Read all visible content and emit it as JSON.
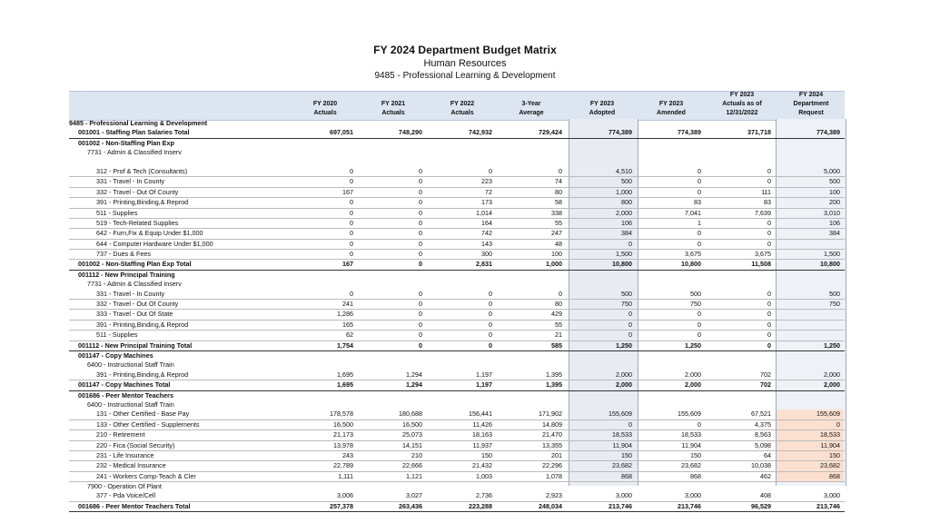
{
  "title": "FY 2024 Department Budget Matrix",
  "subtitle": "Human Resources",
  "subtitle2": "9485 - Professional Learning & Development",
  "columns": [
    [
      "FY 2020",
      "Actuals"
    ],
    [
      "FY 2021",
      "Actuals"
    ],
    [
      "FY 2022",
      "Actuals"
    ],
    [
      "3-Year",
      "Average"
    ],
    [
      "FY 2023",
      "Adopted"
    ],
    [
      "FY 2023",
      "Amended"
    ],
    [
      "FY 2023",
      "Actuals as of",
      "12/31/2022"
    ],
    [
      "FY 2024",
      "Department",
      "Request"
    ]
  ],
  "rows": [
    {
      "label": "9485 - Professional Learning & Development",
      "indent": 0,
      "type": "hd",
      "values": []
    },
    {
      "label": "001001 - Staffing Plan Salaries Total",
      "indent": 1,
      "type": "total",
      "values": [
        "697,051",
        "748,290",
        "742,932",
        "729,424",
        "774,389",
        "774,389",
        "371,718",
        "774,389"
      ]
    },
    {
      "label": "001002 - Non-Staffing Plan Exp",
      "indent": 1,
      "type": "hd",
      "values": []
    },
    {
      "label": "7731 - Admin & Classified Inserv",
      "indent": 2,
      "type": "",
      "values": []
    },
    {
      "label": "",
      "indent": 0,
      "type": "",
      "values": []
    },
    {
      "label": "312 - Prof & Tech (Consultants)",
      "indent": 3,
      "type": "line",
      "values": [
        "0",
        "0",
        "0",
        "0",
        "4,510",
        "0",
        "0",
        "5,000"
      ]
    },
    {
      "label": "331 - Travel - In County",
      "indent": 3,
      "type": "line",
      "values": [
        "0",
        "0",
        "223",
        "74",
        "500",
        "0",
        "0",
        "500"
      ]
    },
    {
      "label": "332 - Travel - Out Of County",
      "indent": 3,
      "type": "line",
      "values": [
        "167",
        "0",
        "72",
        "80",
        "1,000",
        "0",
        "111",
        "100"
      ]
    },
    {
      "label": "391 - Printing,Binding,& Reprod",
      "indent": 3,
      "type": "line",
      "values": [
        "0",
        "0",
        "173",
        "58",
        "800",
        "83",
        "83",
        "200"
      ]
    },
    {
      "label": "511 - Supplies",
      "indent": 3,
      "type": "line",
      "values": [
        "0",
        "0",
        "1,014",
        "338",
        "2,000",
        "7,041",
        "7,639",
        "3,010"
      ]
    },
    {
      "label": "519 - Tech-Related Supplies",
      "indent": 3,
      "type": "line",
      "values": [
        "0",
        "0",
        "164",
        "55",
        "106",
        "1",
        "0",
        "106"
      ]
    },
    {
      "label": "642 - Furn,Fix & Equip Under $1,000",
      "indent": 3,
      "type": "line",
      "values": [
        "0",
        "0",
        "742",
        "247",
        "384",
        "0",
        "0",
        "384"
      ]
    },
    {
      "label": "644 - Computer Hardware Under $1,000",
      "indent": 3,
      "type": "line",
      "values": [
        "0",
        "0",
        "143",
        "48",
        "0",
        "0",
        "0",
        ""
      ]
    },
    {
      "label": "737 - Dues & Fees",
      "indent": 3,
      "type": "line",
      "values": [
        "0",
        "0",
        "300",
        "100",
        "1,500",
        "3,675",
        "3,675",
        "1,500"
      ]
    },
    {
      "label": "001002 - Non-Staffing Plan Exp Total",
      "indent": 1,
      "type": "total",
      "values": [
        "167",
        "0",
        "2,831",
        "1,000",
        "10,800",
        "10,800",
        "11,508",
        "10,800"
      ]
    },
    {
      "label": "001112 - New Principal Training",
      "indent": 1,
      "type": "hd",
      "values": []
    },
    {
      "label": "7731 - Admin & Classified Inserv",
      "indent": 2,
      "type": "",
      "values": []
    },
    {
      "label": "331 - Travel - In County",
      "indent": 3,
      "type": "line",
      "values": [
        "0",
        "0",
        "0",
        "0",
        "500",
        "500",
        "0",
        "500"
      ]
    },
    {
      "label": "332 - Travel - Out Of County",
      "indent": 3,
      "type": "line",
      "values": [
        "241",
        "0",
        "0",
        "80",
        "750",
        "750",
        "0",
        "750"
      ]
    },
    {
      "label": "333 - Travel - Out Of State",
      "indent": 3,
      "type": "line",
      "values": [
        "1,286",
        "0",
        "0",
        "429",
        "0",
        "0",
        "0",
        ""
      ]
    },
    {
      "label": "391 - Printing,Binding,& Reprod",
      "indent": 3,
      "type": "line",
      "values": [
        "165",
        "0",
        "0",
        "55",
        "0",
        "0",
        "0",
        ""
      ]
    },
    {
      "label": "511 - Supplies",
      "indent": 3,
      "type": "line",
      "values": [
        "62",
        "0",
        "0",
        "21",
        "0",
        "0",
        "0",
        ""
      ]
    },
    {
      "label": "001112 - New Principal Training Total",
      "indent": 1,
      "type": "total",
      "values": [
        "1,754",
        "0",
        "0",
        "585",
        "1,250",
        "1,250",
        "0",
        "1,250"
      ]
    },
    {
      "label": "001147 - Copy Machines",
      "indent": 1,
      "type": "hd",
      "values": []
    },
    {
      "label": "6400 - Instructional Staff Train",
      "indent": 2,
      "type": "",
      "values": []
    },
    {
      "label": "391 - Printing,Binding,& Reprod",
      "indent": 3,
      "type": "line",
      "values": [
        "1,695",
        "1,294",
        "1,197",
        "1,395",
        "2,000",
        "2,000",
        "702",
        "2,000"
      ]
    },
    {
      "label": "001147 - Copy Machines Total",
      "indent": 1,
      "type": "total",
      "values": [
        "1,695",
        "1,294",
        "1,197",
        "1,395",
        "2,000",
        "2,000",
        "702",
        "2,000"
      ]
    },
    {
      "label": "001686 - Peer Mentor Teachers",
      "indent": 1,
      "type": "hd",
      "values": []
    },
    {
      "label": "6400 - Instructional Staff Train",
      "indent": 2,
      "type": "",
      "values": []
    },
    {
      "label": "131 - Other Certified - Base Pay",
      "indent": 3,
      "type": "line",
      "hl": true,
      "values": [
        "178,578",
        "180,688",
        "156,441",
        "171,902",
        "155,609",
        "155,609",
        "67,521",
        "155,609"
      ]
    },
    {
      "label": "133 - Other Certified - Supplements",
      "indent": 3,
      "type": "line",
      "hl": true,
      "values": [
        "16,500",
        "16,500",
        "11,426",
        "14,809",
        "0",
        "0",
        "4,375",
        "0"
      ]
    },
    {
      "label": "210 - Retirement",
      "indent": 3,
      "type": "line",
      "hl": true,
      "values": [
        "21,173",
        "25,073",
        "18,163",
        "21,470",
        "18,533",
        "18,533",
        "8,563",
        "18,533"
      ]
    },
    {
      "label": "220 - Fica (Social Security)",
      "indent": 3,
      "type": "line",
      "hl": true,
      "values": [
        "13,978",
        "14,151",
        "11,937",
        "13,355",
        "11,904",
        "11,904",
        "5,098",
        "11,904"
      ]
    },
    {
      "label": "231 - Life Insurance",
      "indent": 3,
      "type": "line",
      "hl": true,
      "values": [
        "243",
        "210",
        "150",
        "201",
        "150",
        "150",
        "64",
        "150"
      ]
    },
    {
      "label": "232 - Medical Insurance",
      "indent": 3,
      "type": "line",
      "hl": true,
      "values": [
        "22,789",
        "22,666",
        "21,432",
        "22,296",
        "23,682",
        "23,682",
        "10,038",
        "23,682"
      ]
    },
    {
      "label": "241 - Workers Comp-Teach & Cler",
      "indent": 3,
      "type": "line",
      "hl": true,
      "values": [
        "1,111",
        "1,121",
        "1,003",
        "1,078",
        "868",
        "868",
        "462",
        "868"
      ]
    },
    {
      "label": "7900 - Operation Of Plant",
      "indent": 2,
      "type": "",
      "values": []
    },
    {
      "label": "377 - Pda Voice/Cell",
      "indent": 3,
      "type": "line",
      "values": [
        "3,006",
        "3,027",
        "2,736",
        "2,923",
        "3,000",
        "3,000",
        "408",
        "3,000"
      ]
    },
    {
      "label": "001686 - Peer Mentor Teachers Total",
      "indent": 1,
      "type": "total",
      "values": [
        "257,378",
        "263,436",
        "223,288",
        "248,034",
        "213,746",
        "213,746",
        "96,529",
        "213,746"
      ]
    }
  ]
}
